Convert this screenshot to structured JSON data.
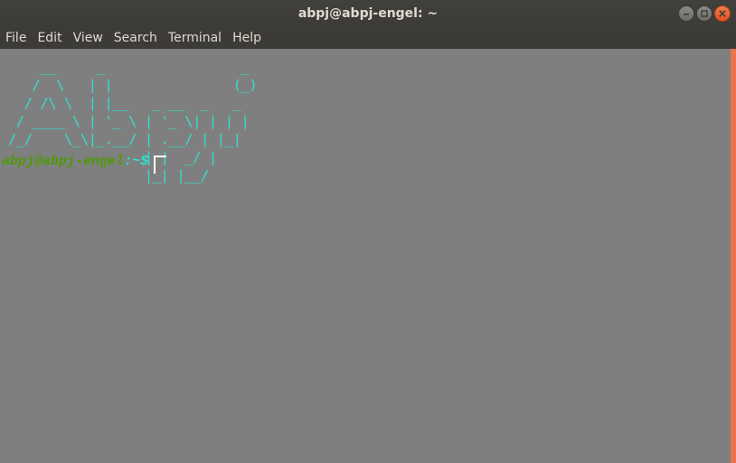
{
  "window": {
    "title": "abpj@abpj-engel: ~"
  },
  "menubar": {
    "items": [
      {
        "label": "File"
      },
      {
        "label": "Edit"
      },
      {
        "label": "View"
      },
      {
        "label": "Search"
      },
      {
        "label": "Terminal"
      },
      {
        "label": "Help"
      }
    ]
  },
  "terminal": {
    "banner": "     __     _                 _\n    /  \\   | |               (_)\n   / /\\ \\  | |__   _ __  _   _\n  / ____ \\ | '_ \\ | '_ \\| | | |\n /_/    \\_\\|_.__/ | .__/ | |_|\n                  | |  _/ |\n                  |_| |__/",
    "prompt": {
      "user_host": "abpj@abpj-engel",
      "colon": ":",
      "path": "~",
      "symbol": "$"
    }
  },
  "colors": {
    "titlebar_bg": "#3c3b37",
    "terminal_bg": "#7f7f7f",
    "banner_text": "#2fe0d0",
    "prompt_user": "#4e9a06",
    "prompt_path": "#2fe0d0",
    "close_button": "#e9734a",
    "scroll_accent": "#e9734a"
  },
  "icons": {
    "minimize": "minimize-icon",
    "maximize": "maximize-icon",
    "close": "close-icon"
  }
}
